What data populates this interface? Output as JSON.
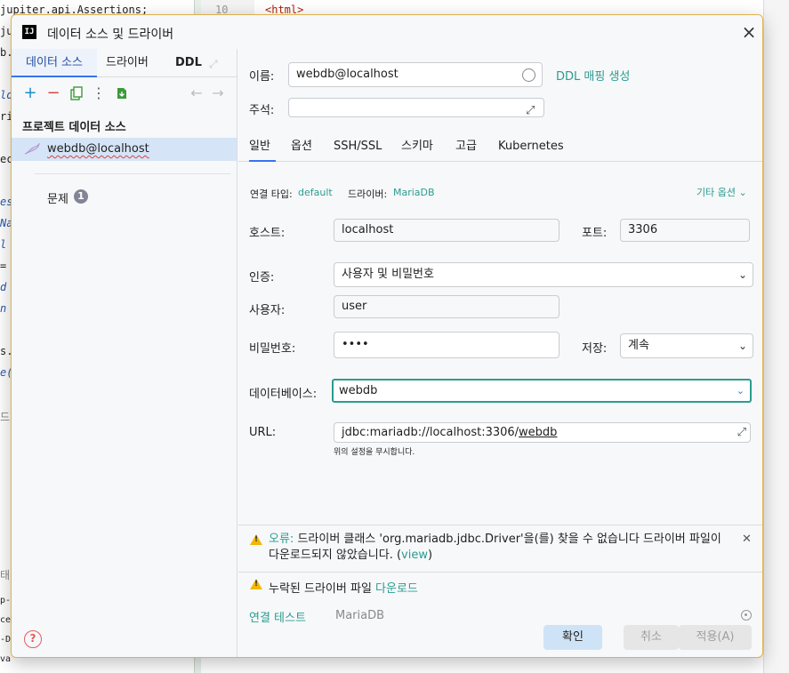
{
  "background": {
    "code_lines": [
      "jupiter.api.Assertions;",
      "jup",
      "b.",
      "lon",
      "ri",
      "ec",
      "es",
      "Na",
      "l",
      " =",
      "d",
      "n",
      "s.",
      "e(",
      "드",
      "태",
      "p-",
      "ce",
      "-D",
      "va"
    ],
    "line_number": "10",
    "code_html_tag": "<html>"
  },
  "dialog": {
    "title": "데이터 소스 및 드라이버",
    "app_logo": "IJ"
  },
  "left": {
    "tabs": {
      "data_sources": "데이터 소스",
      "drivers": "드라이버",
      "ddl": "DDL"
    },
    "project_header": "프로젝트 데이터 소스",
    "data_source_item": "webdb@localhost",
    "problems_label": "문제",
    "problems_count": "1"
  },
  "right": {
    "name_label": "이름:",
    "name_value": "webdb@localhost",
    "ddl_link": "DDL 매핑 생성",
    "comment_label": "주석:",
    "comment_value": "",
    "tabs": [
      "일반",
      "옵션",
      "SSH/SSL",
      "스키마",
      "고급",
      "Kubernetes"
    ],
    "connection_type_label": "연결 타입:",
    "connection_type_value": "default",
    "driver_label": "드라이버:",
    "driver_value": "MariaDB",
    "other_options": "기타 옵션",
    "host_label": "호스트:",
    "host_value": "localhost",
    "port_label": "포트:",
    "port_value": "3306",
    "auth_label": "인증:",
    "auth_value": "사용자 및 비밀번호",
    "user_label": "사용자:",
    "user_value": "user",
    "password_label": "비밀번호:",
    "password_value": "••••",
    "save_label": "저장:",
    "save_value": "계속",
    "database_label": "데이터베이스:",
    "database_value": "webdb",
    "url_label": "URL:",
    "url_prefix": "jdbc:mariadb://localhost:3306/",
    "url_db": "webdb",
    "url_hint": "위의 설정을 무시합니다.",
    "error_prefix": "오류:",
    "error_text": " 드라이버 클래스 'org.mariadb.jdbc.Driver'을(를) 찾을 수 없습니다 드라이버 파일이 다운로드되지 않았습니다. (",
    "error_view": "view",
    "error_suffix": ")",
    "missing_text": "누락된 드라이버 파일 ",
    "download_link": "다운로드",
    "test_connection": "연결 테스트",
    "test_driver": "MariaDB"
  },
  "buttons": {
    "ok": "확인",
    "cancel": "취소",
    "apply": "적용(A)"
  },
  "colors": {
    "accent": "#2a9d8f",
    "tab_underline": "#3574f0",
    "warning": "#f2b705",
    "error": "#d64545"
  }
}
